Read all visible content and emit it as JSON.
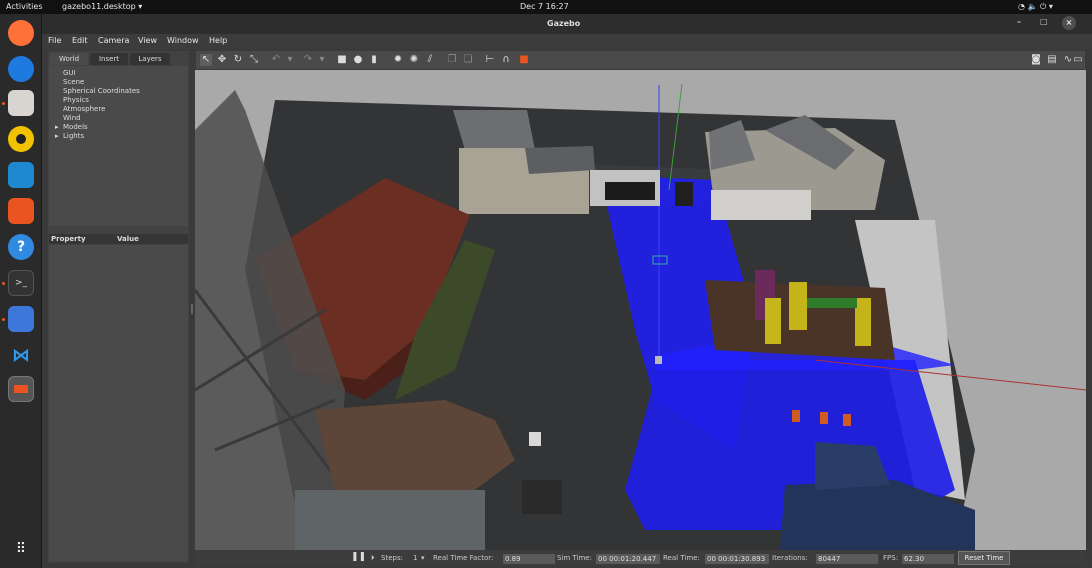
{
  "topbar": {
    "activities": "Activities",
    "app": "gazebo11.desktop",
    "clock": "Dec 7  16:27"
  },
  "dock": {
    "items": [
      "firefox-icon",
      "thunderbird-icon",
      "files-icon",
      "rhythmbox-icon",
      "writer-icon",
      "software-icon",
      "help-icon",
      "terminal-icon",
      "text-editor-icon",
      "vscode-icon",
      "gazebo-icon"
    ],
    "apps_grid": "apps-grid-icon"
  },
  "window": {
    "title": "Gazebo"
  },
  "menubar": {
    "file": "File",
    "edit": "Edit",
    "camera": "Camera",
    "view": "View",
    "window": "Window",
    "help": "Help"
  },
  "left_panel": {
    "tabs": [
      "World",
      "Insert",
      "Layers"
    ],
    "tree": [
      "GUI",
      "Scene",
      "Spherical Coordinates",
      "Physics",
      "Atmosphere",
      "Wind",
      "Models",
      "Lights"
    ],
    "property_header": "Property",
    "value_header": "Value"
  },
  "status": {
    "steps_label": "Steps:",
    "steps_value": "1",
    "rtf_label": "Real Time Factor:",
    "rtf_value": "0.89",
    "sim_time_label": "Sim Time:",
    "sim_time_value": "00 00:01:20.447",
    "real_time_label": "Real Time:",
    "real_time_value": "00 00:01:30.893",
    "iterations_label": "Iterations:",
    "iterations_value": "80447",
    "fps_label": "FPS:",
    "fps_value": "62.30",
    "reset_label": "Reset Time"
  },
  "colors": {
    "accent": "#e95420",
    "sensor_ray": "#1e1eff",
    "panel_bg": "#424242"
  }
}
